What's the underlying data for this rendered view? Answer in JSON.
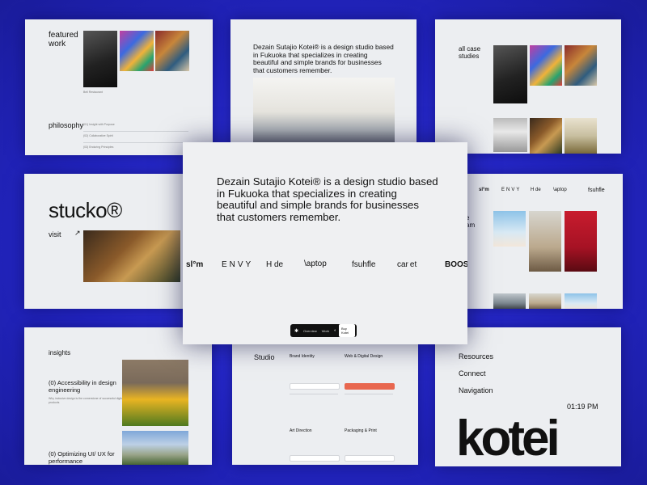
{
  "featured": {
    "title_line1": "featured",
    "title_line2": "work",
    "caption1": "Bell Restaurant",
    "philosophy": "philosophy",
    "phil_items": [
      "(01) Insight with Purpose",
      "(02) Collaborative Spirit",
      "(03) Enduring Principles"
    ]
  },
  "hero_small": {
    "text": "Dezain Sutajio Kotei® is a design studio based in Fukuoka that specializes in creating beautiful and simple brands for businesses that customers remember."
  },
  "cases": {
    "title_line1": "all case",
    "title_line2": "studies"
  },
  "stucko": {
    "name": "stucko®",
    "visit": "visit",
    "arrow": "↗"
  },
  "team": {
    "logos": [
      "sl°m",
      "ENVY",
      "H de",
      "\\aptop",
      "fsuhfle"
    ],
    "fragment_line1": "e",
    "fragment_line2": "am"
  },
  "insights": {
    "title": "insights",
    "post1": "(0) Accessibility in design engineering",
    "post1_sub": "Why inclusive design is the cornerstone of successful digital products",
    "post2": "(0) Optimizing UI/ UX for performance"
  },
  "services": {
    "studio": "Studio",
    "brand_identity": "Brand Identity",
    "web_digital": "Web & Digital Design",
    "art_direction": "Art Direction",
    "packaging": "Packaging & Print",
    "cta": "Get started"
  },
  "footer": {
    "resources": "Resources",
    "connect": "Connect",
    "navigation": "Navigation",
    "time": "01:19 PM",
    "wordmark": "kotei"
  },
  "main": {
    "headline": "Dezain Sutajio Kotei® is a design studio based in Fukuoka that specializes in creating beautiful and simple brands for businesses that customers remember.",
    "logos": [
      "sl°m",
      "ENVY",
      "H de",
      "\\aptop",
      "fsuhfle",
      "car et",
      "BOOS"
    ],
    "tabs": {
      "overview": "Overview",
      "work": "Work",
      "cta": "Buy Kotei"
    }
  }
}
